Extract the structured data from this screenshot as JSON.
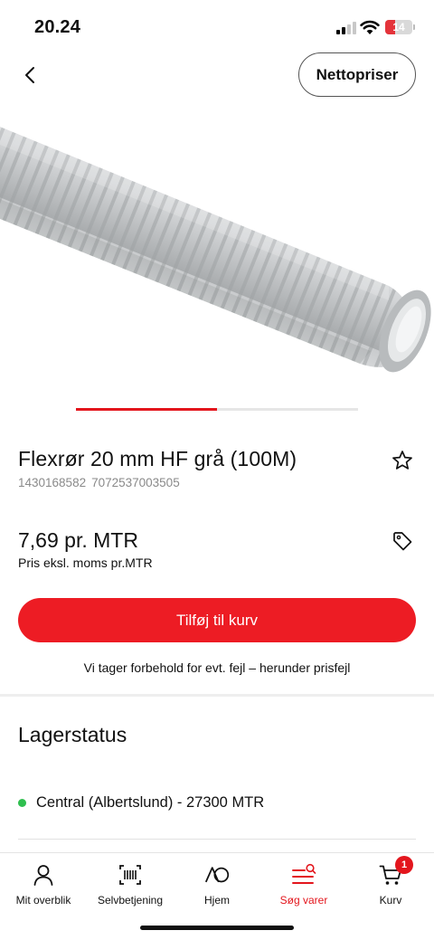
{
  "status_bar": {
    "time": "20.24",
    "battery_level": "14",
    "icons": [
      "signal-icon",
      "wifi-icon",
      "battery-icon"
    ]
  },
  "header": {
    "back_icon": "chevron-left-icon",
    "netto_label": "Nettopriser"
  },
  "carousel": {
    "active_index": 1,
    "total": 2
  },
  "product": {
    "title": "Flexrør 20 mm HF grå (100M)",
    "id_1": "1430168582",
    "id_2": "7072537003505",
    "price": "7,69 pr. MTR",
    "price_note": "Pris eksl. moms pr.MTR",
    "favorite_icon": "star-icon",
    "tag_icon": "price-tag-icon"
  },
  "actions": {
    "add_to_cart_label": "Tilføj til kurv",
    "disclaimer": "Vi tager forbehold for evt. fejl – herunder prisfejl"
  },
  "stock": {
    "heading": "Lagerstatus",
    "entry": "Central (Albertslund) - 27300 MTR",
    "status_color": "#2fbf4f"
  },
  "tab_bar": {
    "tabs": [
      {
        "label": "Mit overblik",
        "icon": "person-icon"
      },
      {
        "label": "Selvbetjening",
        "icon": "barcode-scanner-icon"
      },
      {
        "label": "Hjem",
        "icon": "ao-logo-icon"
      },
      {
        "label": "Søg varer",
        "icon": "search-menu-icon",
        "active": true
      },
      {
        "label": "Kurv",
        "icon": "cart-icon",
        "badge": "1"
      }
    ]
  },
  "colors": {
    "accent": "#ed1c24",
    "text": "#111111",
    "muted": "#8a8a8a"
  }
}
